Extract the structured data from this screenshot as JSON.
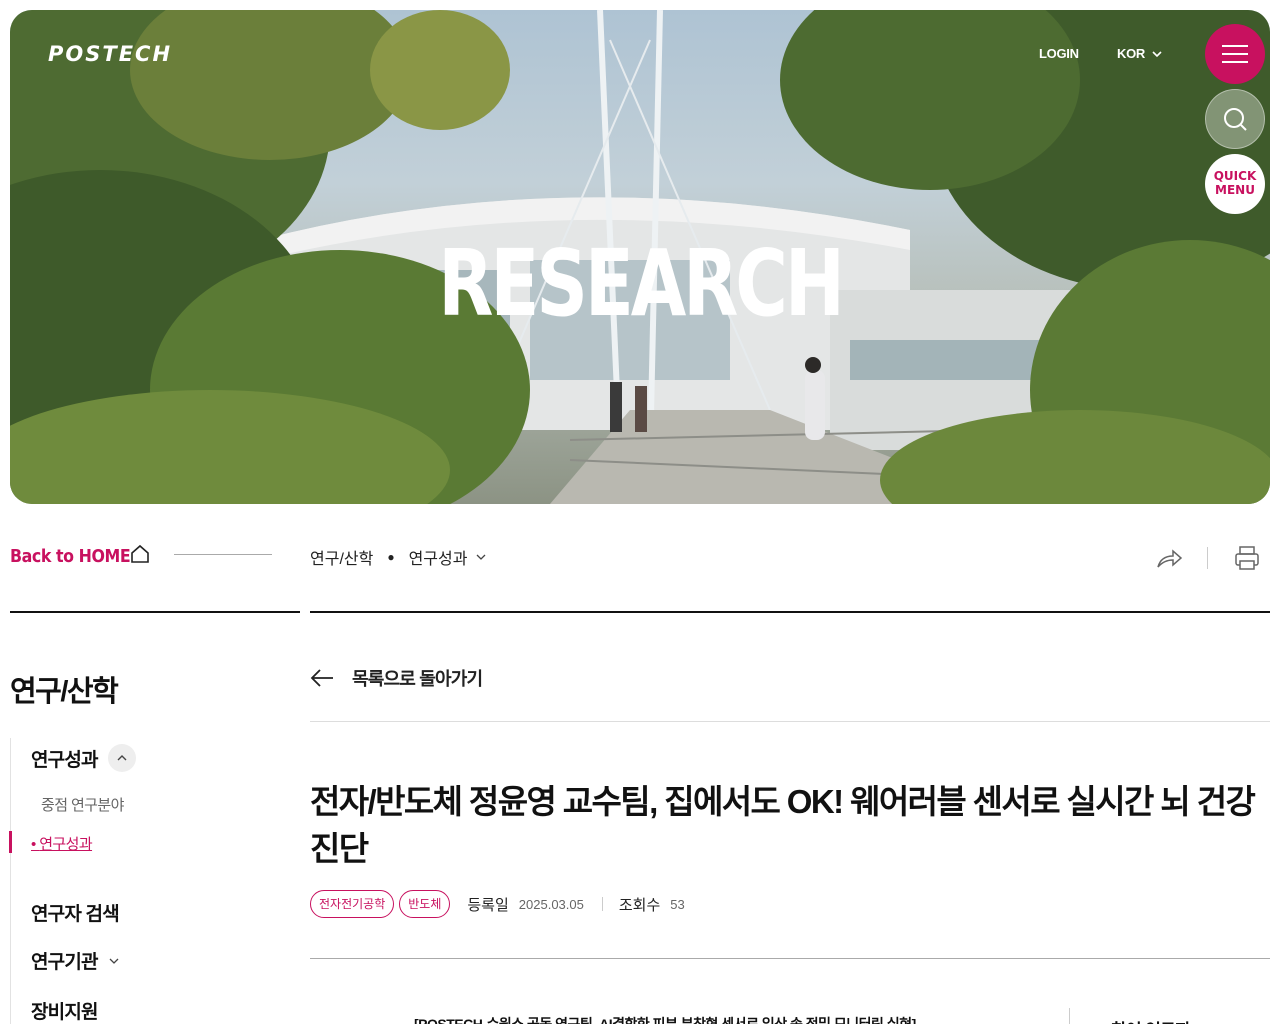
{
  "header": {
    "logo": "POSTECH",
    "login": "LOGIN",
    "language": "KOR",
    "hero_title": "RESEARCH",
    "quick_menu_line1": "QUICK",
    "quick_menu_line2": "MENU"
  },
  "breadcrumb": {
    "back_home": "Back to HOME",
    "level1": "연구/산학",
    "level2": "연구성과"
  },
  "sidebar": {
    "title": "연구/산학",
    "items": [
      {
        "label": "연구성과"
      },
      {
        "label": "연구자 검색"
      },
      {
        "label": "연구기관"
      },
      {
        "label": "장비지원"
      }
    ],
    "subitems": [
      {
        "label": "중점 연구분야"
      },
      {
        "label": "연구성과"
      }
    ]
  },
  "article": {
    "back_label": "목록으로 돌아가기",
    "title": "전자/반도체 정윤영 교수팀, 집에서도 OK! 웨어러블 센서로 실시간 뇌 건강 진단",
    "tags": [
      "전자전기공학",
      "반도체"
    ],
    "date_label": "등록일",
    "date": "2025.03.05",
    "views_label": "조회수",
    "views": "53",
    "lead": "[POSTECH-수원소 공동 연구팀, AI결합한 피부 부착형 센서로 일상 속 정밀 모니터링 실현]",
    "related_title": "참여 연구자"
  },
  "colors": {
    "brand": "#c8115f",
    "text": "#111111"
  }
}
